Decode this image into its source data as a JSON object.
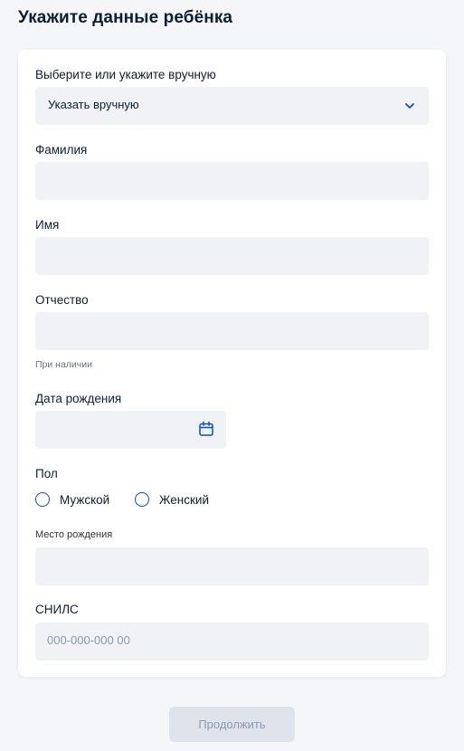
{
  "page": {
    "title": "Укажите данные ребёнка"
  },
  "form": {
    "select": {
      "label": "Выберите или укажите вручную",
      "value": "Указать вручную"
    },
    "last_name": {
      "label": "Фамилия",
      "value": ""
    },
    "first_name": {
      "label": "Имя",
      "value": ""
    },
    "patronymic": {
      "label": "Отчество",
      "value": "",
      "hint": "При наличии"
    },
    "birth_date": {
      "label": "Дата рождения",
      "value": ""
    },
    "gender": {
      "label": "Пол",
      "options": [
        "Мужской",
        "Женский"
      ]
    },
    "birth_place": {
      "label": "Место рождения",
      "value": ""
    },
    "snils": {
      "label": "СНИЛС",
      "placeholder": "000-000-000 00"
    }
  },
  "actions": {
    "continue_label": "Продолжить"
  },
  "colors": {
    "accent": "#0d4cd3",
    "field_bg": "#f0f2f6",
    "page_bg": "#f4f6f9",
    "button_disabled_bg": "#dfe4ec"
  }
}
